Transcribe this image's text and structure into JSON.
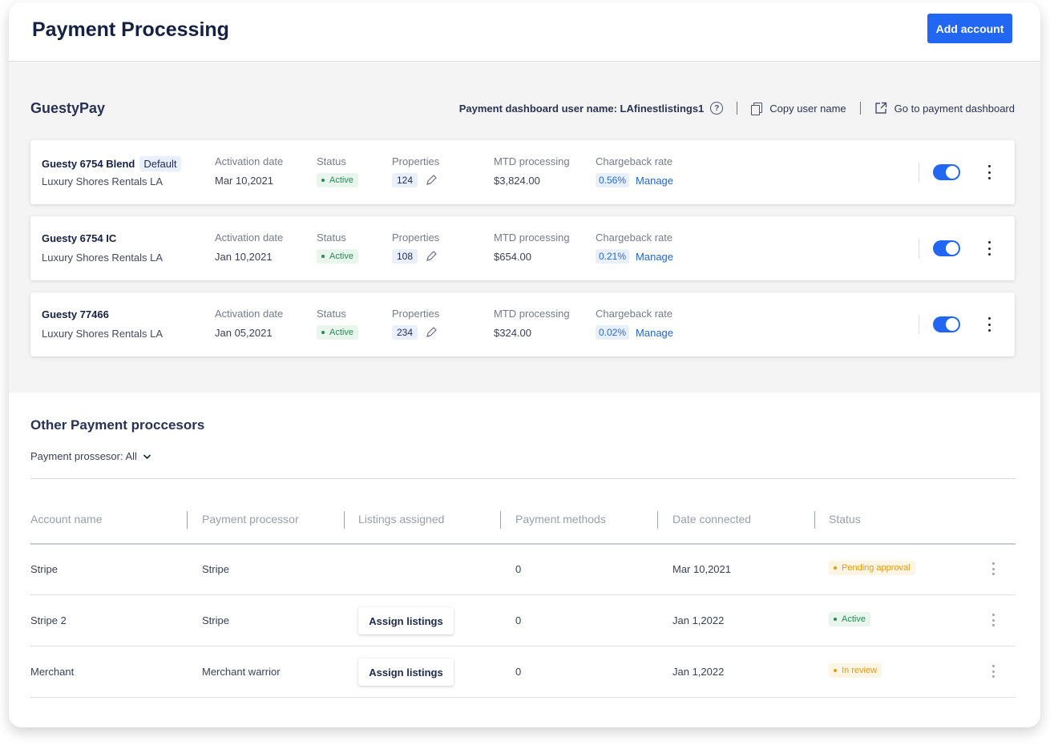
{
  "header": {
    "title": "Payment Processing",
    "add_account_label": "Add account"
  },
  "guestypay": {
    "title": "GuestyPay",
    "dashboard_user_label": "Payment dashboard user name: LAfinestlistings1",
    "help_icon": "help-circle-icon",
    "copy_label": "Copy user name",
    "go_to_dashboard_label": "Go to payment dashboard",
    "column_labels": {
      "activation": "Activation date",
      "status": "Status",
      "properties": "Properties",
      "mtd": "MTD processing",
      "chargeback": "Chargeback rate"
    },
    "manage_label": "Manage",
    "accounts": [
      {
        "name": "Guesty 6754 Blend",
        "default_badge": "Default",
        "subtitle": "Luxury Shores Rentals LA",
        "activation_date": "Mar 10,2021",
        "status": "Active",
        "properties": "124",
        "mtd": "$3,824.00",
        "chargeback_rate": "0.56%",
        "enabled": true
      },
      {
        "name": "Guesty 6754 IC",
        "default_badge": "",
        "subtitle": "Luxury Shores Rentals LA",
        "activation_date": "Jan 10,2021",
        "status": "Active",
        "properties": "108",
        "mtd": "$654.00",
        "chargeback_rate": "0.21%",
        "enabled": true
      },
      {
        "name": "Guesty 77466",
        "default_badge": "",
        "subtitle": "Luxury Shores Rentals LA",
        "activation_date": "Jan 05,2021",
        "status": "Active",
        "properties": "234",
        "mtd": "$324.00",
        "chargeback_rate": "0.02%",
        "enabled": true
      }
    ]
  },
  "other": {
    "title": "Other Payment proccesors",
    "filter_label": "Payment prossesor: All",
    "columns": [
      "Account name",
      "Payment processor",
      "Listings assigned",
      "Payment methods",
      "Date connected",
      "Status"
    ],
    "assign_label": "Assign listings",
    "rows": [
      {
        "account_name": "Stripe",
        "processor": "Stripe",
        "has_assign": false,
        "payment_methods": "0",
        "date_connected": "Mar 10,2021",
        "status": "Pending approval",
        "status_type": "pending"
      },
      {
        "account_name": "Stripe 2",
        "processor": "Stripe",
        "has_assign": true,
        "payment_methods": "0",
        "date_connected": "Jan 1,2022",
        "status": "Active",
        "status_type": "active"
      },
      {
        "account_name": "Merchant",
        "processor": "Merchant warrior",
        "has_assign": true,
        "payment_methods": "0",
        "date_connected": "Jan 1,2022",
        "status": "In review",
        "status_type": "review"
      }
    ]
  },
  "colors": {
    "primary": "#2167f3",
    "active_green": "#238e50",
    "pending_orange": "#e59a11",
    "title_navy": "#152043"
  }
}
